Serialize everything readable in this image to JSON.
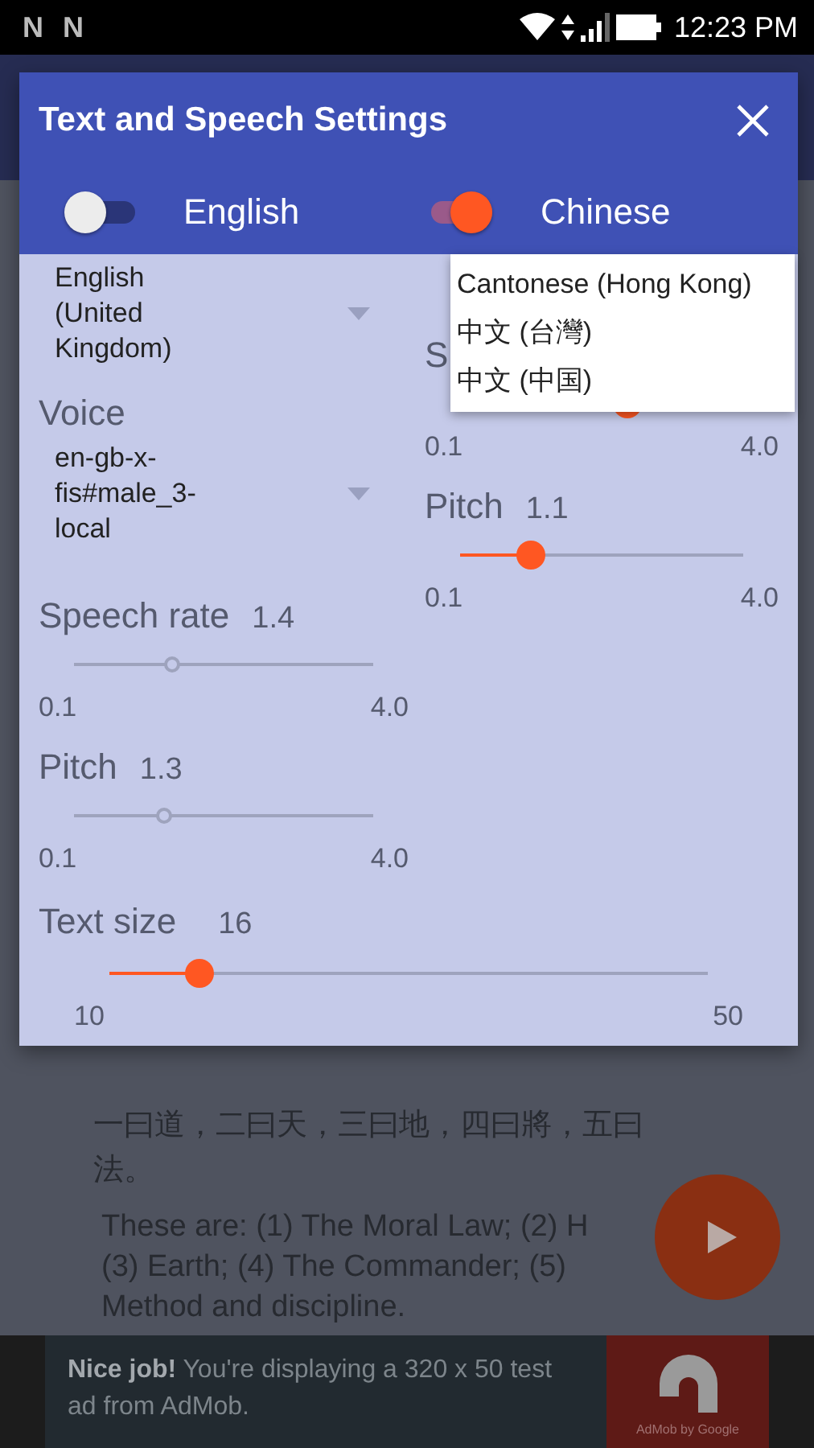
{
  "status_bar": {
    "notifications": [
      "N",
      "N"
    ],
    "time": "12:23 PM"
  },
  "dialog": {
    "title": "Text and Speech Settings",
    "languages": [
      {
        "name": "English",
        "on": false,
        "spinner": "English (United Kingdom)",
        "voice_label": "Voice",
        "voice": "en-gb-x-fis#male_3-local",
        "speech_rate": {
          "label": "Speech rate",
          "value": "1.4",
          "level": 0.33,
          "min": "0.1",
          "max": "4.0"
        },
        "pitch": {
          "label": "Pitch",
          "value": "1.3",
          "level": 0.3,
          "min": "0.1",
          "max": "4.0"
        }
      },
      {
        "name": "Chinese",
        "on": true,
        "speech_rate": {
          "label": "S",
          "level": 0.59,
          "min": "0.1",
          "max": "4.0"
        },
        "pitch": {
          "label": "Pitch",
          "value": "1.1",
          "level": 0.25,
          "min": "0.1",
          "max": "4.0"
        }
      }
    ],
    "dropdown": [
      "Cantonese (Hong Kong)",
      "中文 (台灣)",
      "中文 (中国)"
    ],
    "text_size": {
      "label": "Text size",
      "value": "16",
      "level": 0.15,
      "min": "10",
      "max": "50"
    }
  },
  "content": {
    "lines": [
      "一曰道，二曰天，三曰地，四曰將，五曰法。",
      "These are: (1) The Moral Law; (2) H",
      "(3) Earth; (4) The Commander; (5)",
      "Method and discipline."
    ]
  },
  "ad": {
    "text": "**Nice job!** You're displaying a 320 x 50 test ad from AdMob.",
    "logo_caption": "AdMob by Google"
  }
}
